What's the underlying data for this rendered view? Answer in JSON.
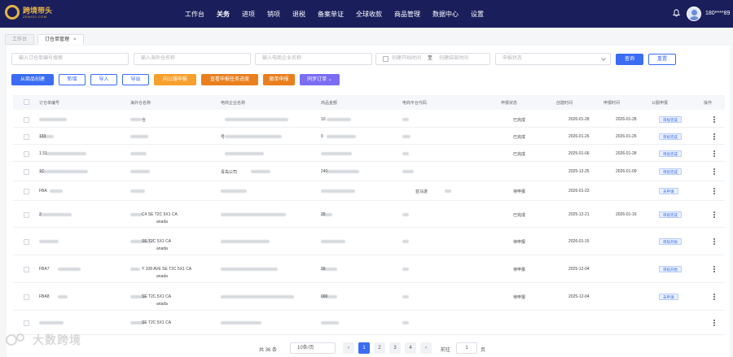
{
  "brand": {
    "name_cn": "跨境带头",
    "name_en": "ZEMOO.COM",
    "accent": "#e5b444",
    "nav_bg": "#1a1f5c"
  },
  "nav": [
    "工作台",
    "关务",
    "进项",
    "销项",
    "退税",
    "备案单证",
    "全球收款",
    "商品管理",
    "数据中心",
    "设置"
  ],
  "user": {
    "phone": "180****89"
  },
  "tabs": [
    {
      "label": "工作台"
    },
    {
      "label": "订仓单管理",
      "close": "×"
    }
  ],
  "filters": {
    "order_no": "输入订仓单编号搜索",
    "overseas_wh": "输入海外仓名称",
    "ecom_company": "输入电商企业名称",
    "date_start": "创建开始时间",
    "date_sep": "至",
    "date_end": "创建结束时间",
    "status": "申报状态",
    "search": "查询",
    "reset": "重置"
  },
  "actions": [
    "从商品创建",
    "新增",
    "导入",
    "导出",
    "向公服申报",
    "查看申报任务进度",
    "撤单申报",
    "同步订单"
  ],
  "table": {
    "headers": [
      "订仓单编号",
      "海外仓名称",
      "电商企业名称",
      "商品金额",
      "电商平台代码",
      "申报状态",
      "创建时间",
      "申报时间",
      "公服申报",
      "操作"
    ],
    "rows": [
      {
        "no": "",
        "wh": "仓",
        "ecom": "",
        "amount": "10",
        "platform": "",
        "status": "已完成",
        "created": "2026-01-28",
        "declared": "2026-01-28",
        "tag": "审核完成"
      },
      {
        "no": "133",
        "wh": "",
        "ecom": "号",
        "amount": "0",
        "platform": "",
        "status": "已完成",
        "created": "2026-01-26",
        "declared": "2026-01-26",
        "tag": "审核完成"
      },
      {
        "no": "1:31",
        "wh": "",
        "ecom": "",
        "amount": "",
        "platform": "",
        "status": "已完成",
        "created": "2025-01-06",
        "declared": "2026-01-28",
        "tag": "审核完成"
      },
      {
        "no": "1C",
        "wh": "",
        "ecom": "青岛公司",
        "amount": "240",
        "platform": "",
        "status": "",
        "created": "2025-12-25",
        "declared": "2026-01-09",
        "tag": "审核完成"
      },
      {
        "no": "FBA",
        "wh": "",
        "ecom": "",
        "amount": "",
        "platform": "亚马逊",
        "status": "待申报",
        "created": "2026-01-23",
        "declared": "",
        "tag": "未申请"
      },
      {
        "no": "2",
        "wh": "C4 SE T2C 5X1 CA",
        "wh2": "anada",
        "ecom": "",
        "amount": "25",
        "platform": "",
        "status": "已完成",
        "created": "2025-12-21",
        "declared": "2026-01-16",
        "tag": "审核完成"
      },
      {
        "no": "",
        "wh": "SE T2C 5X1 CA",
        "wh2": "anada",
        "ecom": "",
        "amount": "",
        "platform": "",
        "status": "待申报",
        "created": "2026-01-15",
        "declared": "",
        "tag": "审核开始"
      },
      {
        "no": "FBA7",
        "wh": "Y 108 AVE SE T2C 5X1 CA",
        "wh2": "anada",
        "ecom": "",
        "amount": "26",
        "platform": "",
        "status": "待申报",
        "created": "2025-12-04",
        "declared": "",
        "tag": "审核开始"
      },
      {
        "no": "FBA8",
        "wh": "SE T2C 5X1 CA",
        "wh2": "anada",
        "ecom": "",
        "amount": "000",
        "platform": "",
        "status": "待申报",
        "created": "2025-12-04",
        "declared": "",
        "tag": "未申请"
      },
      {
        "no": "",
        "wh": "SE T2C 5X1 CA",
        "wh2": "",
        "ecom": "",
        "amount": "",
        "platform": "",
        "status": "",
        "created": "",
        "declared": "",
        "tag": ""
      }
    ]
  },
  "pagination": {
    "total": "共 36 条",
    "page_size": "10条/页",
    "pages": [
      "1",
      "2",
      "3",
      "4"
    ],
    "prev": "‹",
    "next": "›",
    "goto_label": "前往",
    "goto_value": "1",
    "page_suffix": "页"
  },
  "watermark": "大数跨境"
}
